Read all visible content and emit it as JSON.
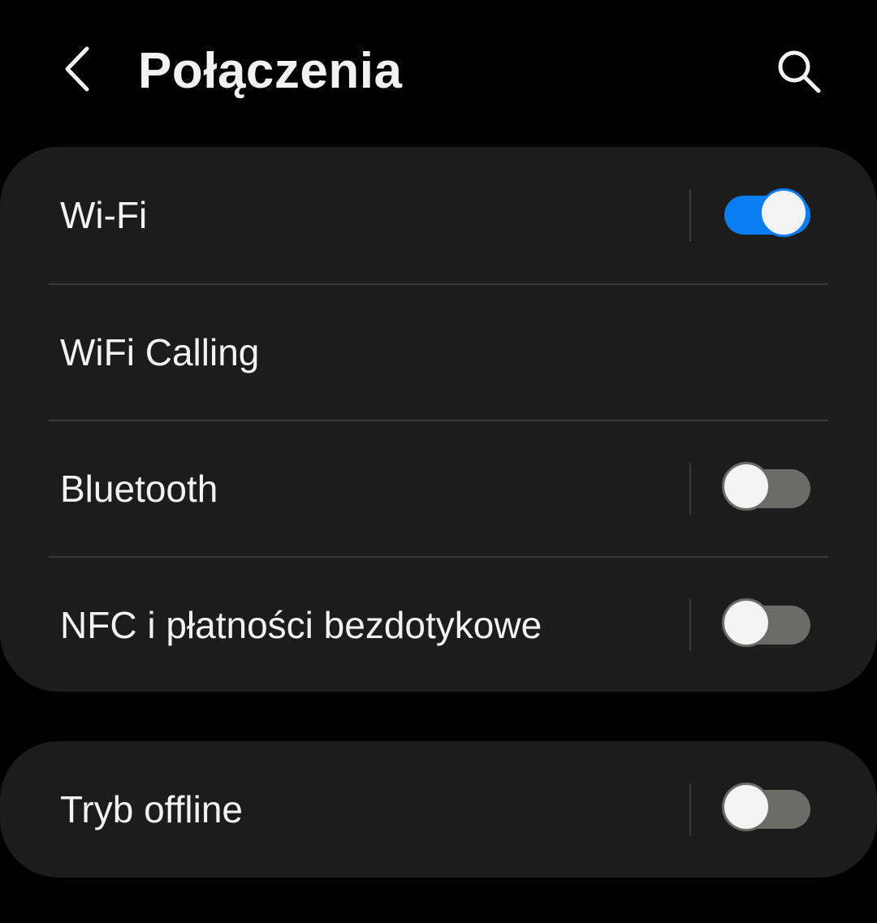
{
  "header": {
    "title": "Połączenia",
    "back_icon": "chevron-left-icon",
    "search_icon": "search-icon"
  },
  "connections": {
    "items": [
      {
        "label": "Wi-Fi",
        "toggle": true,
        "enabled": true
      },
      {
        "label": "WiFi Calling",
        "toggle": false
      },
      {
        "label": "Bluetooth",
        "toggle": true,
        "enabled": false
      },
      {
        "label": "NFC i płatności bezdotykowe",
        "toggle": true,
        "enabled": false
      }
    ]
  },
  "offline": {
    "label": "Tryb offline",
    "toggle": true,
    "enabled": false
  },
  "colors": {
    "background": "#000000",
    "card": "#1c1c1c",
    "accent": "#0b7df2",
    "toggle_off": "#6b6b68",
    "text": "#f2f2f2"
  }
}
